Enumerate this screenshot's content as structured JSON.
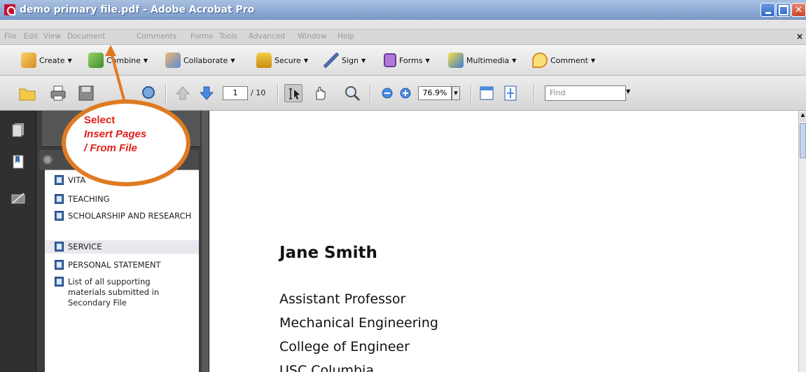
{
  "window": {
    "title": "demo primary file.pdf - Adobe Acrobat Pro"
  },
  "menu": {
    "items": [
      "File",
      "Edit",
      "View",
      "Document",
      "Comments",
      "Forms",
      "Tools",
      "Advanced",
      "Window",
      "Help"
    ],
    "close_label": "×"
  },
  "tasks": {
    "create": "Create",
    "combine": "Combine",
    "collaborate": "Collaborate",
    "secure": "Secure",
    "sign": "Sign",
    "forms": "Forms",
    "multimedia": "Multimedia",
    "comment": "Comment"
  },
  "navigation": {
    "current_page": "1",
    "page_count": "/ 10",
    "zoom": "76.9%",
    "find_placeholder": "Find"
  },
  "bookmarks": [
    {
      "label": "VITA"
    },
    {
      "label": "TEACHING"
    },
    {
      "label": "SCHOLARSHIP AND RESEARCH"
    },
    {
      "label": "SERVICE",
      "selected": true
    },
    {
      "label": "PERSONAL STATEMENT"
    },
    {
      "label": "List of all supporting materials submitted in Secondary File"
    }
  ],
  "document": {
    "name": "Jane Smith",
    "lines": [
      "Assistant Professor",
      "Mechanical Engineering",
      "College of Engineer",
      "USC Columbia"
    ]
  },
  "callout": {
    "line1": "Select",
    "line2": "Insert Pages",
    "line3": "/ From File",
    "color": "#e0201a",
    "border_color": "#e07a22"
  },
  "icons": {
    "pdf": "acrobat-pdf-icon",
    "open": "folder-open-icon",
    "print": "printer-icon",
    "save": "floppy-disk-icon",
    "search": "search-icon",
    "prev": "arrow-up-icon",
    "next": "arrow-down-icon",
    "select": "select-text-icon",
    "hand": "hand-icon",
    "zoom_tool": "zoom-marquee-icon",
    "zoom_out": "zoom-out-icon",
    "zoom_in": "zoom-in-icon",
    "fit_width": "fit-width-icon",
    "fit_page": "fit-page-icon",
    "pages": "pages-panel-icon",
    "bookmarks": "bookmarks-panel-icon",
    "signatures": "signatures-panel-icon",
    "options": "options-gear-icon"
  }
}
